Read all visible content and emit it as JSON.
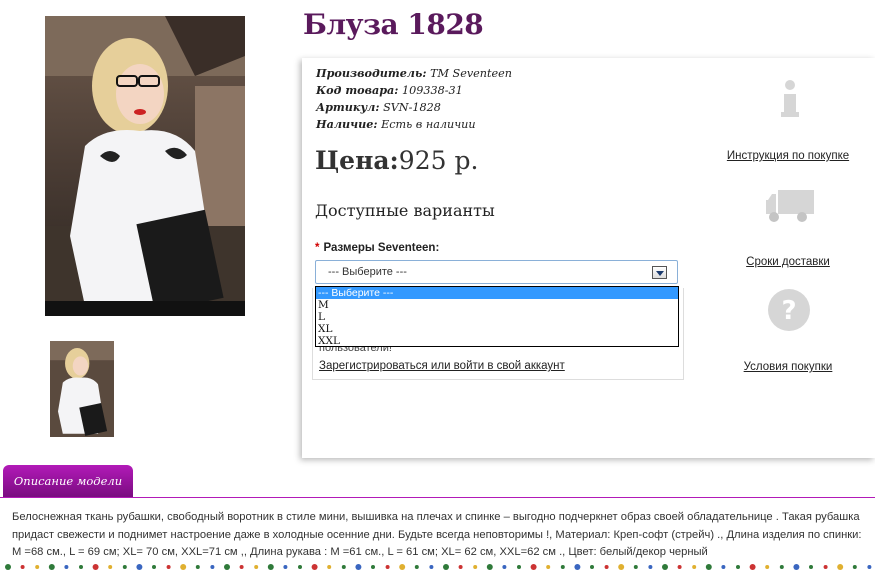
{
  "product": {
    "title": "Блуза 1828",
    "manufacturer_label": "Производитель:",
    "manufacturer_value": "TM Seventeen",
    "code_label": "Код товара:",
    "code_value": "109338-31",
    "sku_label": "Артикул:",
    "sku_value": "SVN-1828",
    "availability_label": "Наличие:",
    "availability_value": "Есть в наличии",
    "price_label": "Цена:",
    "price_value": "925 р."
  },
  "options": {
    "heading": "Доступные варианты",
    "required_mark": "*",
    "size_label": "Размеры Seventeen:",
    "selected": "--- Выберите ---",
    "items": [
      "--- Выберите ---",
      "M",
      "L",
      "XL",
      "XXL"
    ]
  },
  "login": {
    "text": "пользователи!",
    "link": "Зарегистрироваться или войти в свой аккаунт"
  },
  "side_links": {
    "instructions": "Инструкция по покупке",
    "delivery": "Сроки доставки",
    "terms": "Условия покупки"
  },
  "description": {
    "tab": "Описание модели",
    "text": "Белоснежная ткань рубашки, свободный воротник в стиле мини, вышивка на плечах и спинке – выгодно подчеркнет образ своей обладательнице . Такая рубашка придаст свежести и поднимет настроение даже в холодные осенние дни. Будьте всегда неповторимы !, Материал: Креп-софт (стрейч) ., Длина изделия по спинки: M =68 см., L = 69 см; XL= 70 см, XXL=71 см ,, Длина рукава : M =61 см., L = 61 см; XL= 62 см, XXL=62 см ., Цвет: белый/декор черный"
  },
  "colors": {
    "title": "#5a1a5c",
    "tab": "#9c1aa2",
    "select_highlight": "#3399ff",
    "icon": "#dcdcdc"
  },
  "icons": {
    "info": "info-icon",
    "delivery": "truck-icon",
    "help": "question-icon"
  }
}
